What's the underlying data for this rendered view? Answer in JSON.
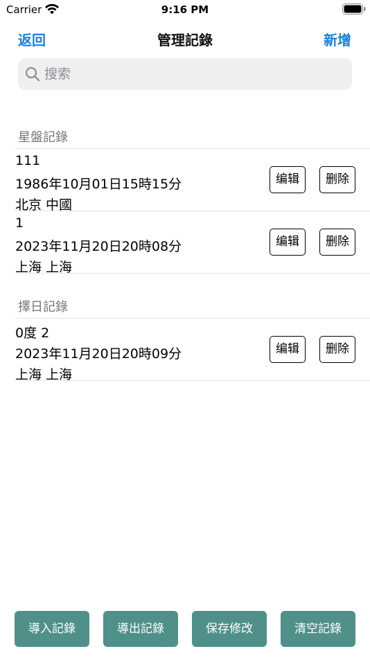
{
  "status_bar": {
    "carrier": "Carrier",
    "time": "9:16 PM"
  },
  "nav": {
    "back_label": "返回",
    "title": "管理記錄",
    "add_label": "新增"
  },
  "search": {
    "placeholder": "搜索",
    "value": ""
  },
  "sections": [
    {
      "header": "星盤記錄",
      "records": [
        {
          "name": "111",
          "datetime": "1986年10月01日15時15分",
          "location": "北京 中國",
          "edit_label": "编辑",
          "delete_label": "删除"
        },
        {
          "name": "1",
          "datetime": "2023年11月20日20時08分",
          "location": "上海 上海",
          "edit_label": "编辑",
          "delete_label": "删除"
        }
      ]
    },
    {
      "header": "擇日記錄",
      "records": [
        {
          "name": "0度 2",
          "datetime": "2023年11月20日20時09分",
          "location": "上海 上海",
          "edit_label": "编辑",
          "delete_label": "删除"
        }
      ]
    }
  ],
  "bottom_buttons": {
    "import_label": "導入記錄",
    "export_label": "導出記錄",
    "save_label": "保存修改",
    "clear_label": "清空記錄"
  },
  "colors": {
    "accent": "#1a7fe6",
    "bottom_button": "#4f9188",
    "search_bg": "#efeff0"
  },
  "icons": {
    "wifi": "wifi-icon",
    "battery": "battery-icon",
    "search": "search-icon"
  }
}
